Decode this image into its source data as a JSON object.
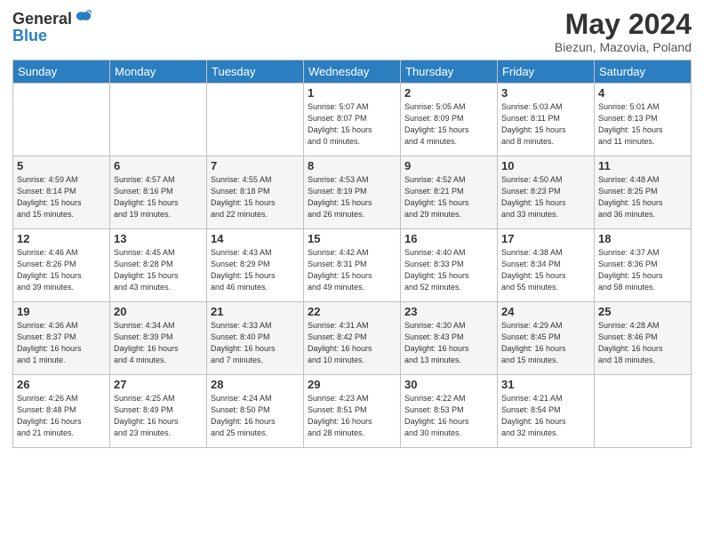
{
  "logo": {
    "general": "General",
    "blue": "Blue"
  },
  "title": "May 2024",
  "subtitle": "Biezun, Mazovia, Poland",
  "days_of_week": [
    "Sunday",
    "Monday",
    "Tuesday",
    "Wednesday",
    "Thursday",
    "Friday",
    "Saturday"
  ],
  "weeks": [
    [
      {
        "day": "",
        "info": ""
      },
      {
        "day": "",
        "info": ""
      },
      {
        "day": "",
        "info": ""
      },
      {
        "day": "1",
        "info": "Sunrise: 5:07 AM\nSunset: 8:07 PM\nDaylight: 15 hours\nand 0 minutes."
      },
      {
        "day": "2",
        "info": "Sunrise: 5:05 AM\nSunset: 8:09 PM\nDaylight: 15 hours\nand 4 minutes."
      },
      {
        "day": "3",
        "info": "Sunrise: 5:03 AM\nSunset: 8:11 PM\nDaylight: 15 hours\nand 8 minutes."
      },
      {
        "day": "4",
        "info": "Sunrise: 5:01 AM\nSunset: 8:13 PM\nDaylight: 15 hours\nand 11 minutes."
      }
    ],
    [
      {
        "day": "5",
        "info": "Sunrise: 4:59 AM\nSunset: 8:14 PM\nDaylight: 15 hours\nand 15 minutes."
      },
      {
        "day": "6",
        "info": "Sunrise: 4:57 AM\nSunset: 8:16 PM\nDaylight: 15 hours\nand 19 minutes."
      },
      {
        "day": "7",
        "info": "Sunrise: 4:55 AM\nSunset: 8:18 PM\nDaylight: 15 hours\nand 22 minutes."
      },
      {
        "day": "8",
        "info": "Sunrise: 4:53 AM\nSunset: 8:19 PM\nDaylight: 15 hours\nand 26 minutes."
      },
      {
        "day": "9",
        "info": "Sunrise: 4:52 AM\nSunset: 8:21 PM\nDaylight: 15 hours\nand 29 minutes."
      },
      {
        "day": "10",
        "info": "Sunrise: 4:50 AM\nSunset: 8:23 PM\nDaylight: 15 hours\nand 33 minutes."
      },
      {
        "day": "11",
        "info": "Sunrise: 4:48 AM\nSunset: 8:25 PM\nDaylight: 15 hours\nand 36 minutes."
      }
    ],
    [
      {
        "day": "12",
        "info": "Sunrise: 4:46 AM\nSunset: 8:26 PM\nDaylight: 15 hours\nand 39 minutes."
      },
      {
        "day": "13",
        "info": "Sunrise: 4:45 AM\nSunset: 8:28 PM\nDaylight: 15 hours\nand 43 minutes."
      },
      {
        "day": "14",
        "info": "Sunrise: 4:43 AM\nSunset: 8:29 PM\nDaylight: 15 hours\nand 46 minutes."
      },
      {
        "day": "15",
        "info": "Sunrise: 4:42 AM\nSunset: 8:31 PM\nDaylight: 15 hours\nand 49 minutes."
      },
      {
        "day": "16",
        "info": "Sunrise: 4:40 AM\nSunset: 8:33 PM\nDaylight: 15 hours\nand 52 minutes."
      },
      {
        "day": "17",
        "info": "Sunrise: 4:38 AM\nSunset: 8:34 PM\nDaylight: 15 hours\nand 55 minutes."
      },
      {
        "day": "18",
        "info": "Sunrise: 4:37 AM\nSunset: 8:36 PM\nDaylight: 15 hours\nand 58 minutes."
      }
    ],
    [
      {
        "day": "19",
        "info": "Sunrise: 4:36 AM\nSunset: 8:37 PM\nDaylight: 16 hours\nand 1 minute."
      },
      {
        "day": "20",
        "info": "Sunrise: 4:34 AM\nSunset: 8:39 PM\nDaylight: 16 hours\nand 4 minutes."
      },
      {
        "day": "21",
        "info": "Sunrise: 4:33 AM\nSunset: 8:40 PM\nDaylight: 16 hours\nand 7 minutes."
      },
      {
        "day": "22",
        "info": "Sunrise: 4:31 AM\nSunset: 8:42 PM\nDaylight: 16 hours\nand 10 minutes."
      },
      {
        "day": "23",
        "info": "Sunrise: 4:30 AM\nSunset: 8:43 PM\nDaylight: 16 hours\nand 13 minutes."
      },
      {
        "day": "24",
        "info": "Sunrise: 4:29 AM\nSunset: 8:45 PM\nDaylight: 16 hours\nand 15 minutes."
      },
      {
        "day": "25",
        "info": "Sunrise: 4:28 AM\nSunset: 8:46 PM\nDaylight: 16 hours\nand 18 minutes."
      }
    ],
    [
      {
        "day": "26",
        "info": "Sunrise: 4:26 AM\nSunset: 8:48 PM\nDaylight: 16 hours\nand 21 minutes."
      },
      {
        "day": "27",
        "info": "Sunrise: 4:25 AM\nSunset: 8:49 PM\nDaylight: 16 hours\nand 23 minutes."
      },
      {
        "day": "28",
        "info": "Sunrise: 4:24 AM\nSunset: 8:50 PM\nDaylight: 16 hours\nand 25 minutes."
      },
      {
        "day": "29",
        "info": "Sunrise: 4:23 AM\nSunset: 8:51 PM\nDaylight: 16 hours\nand 28 minutes."
      },
      {
        "day": "30",
        "info": "Sunrise: 4:22 AM\nSunset: 8:53 PM\nDaylight: 16 hours\nand 30 minutes."
      },
      {
        "day": "31",
        "info": "Sunrise: 4:21 AM\nSunset: 8:54 PM\nDaylight: 16 hours\nand 32 minutes."
      },
      {
        "day": "",
        "info": ""
      }
    ]
  ]
}
